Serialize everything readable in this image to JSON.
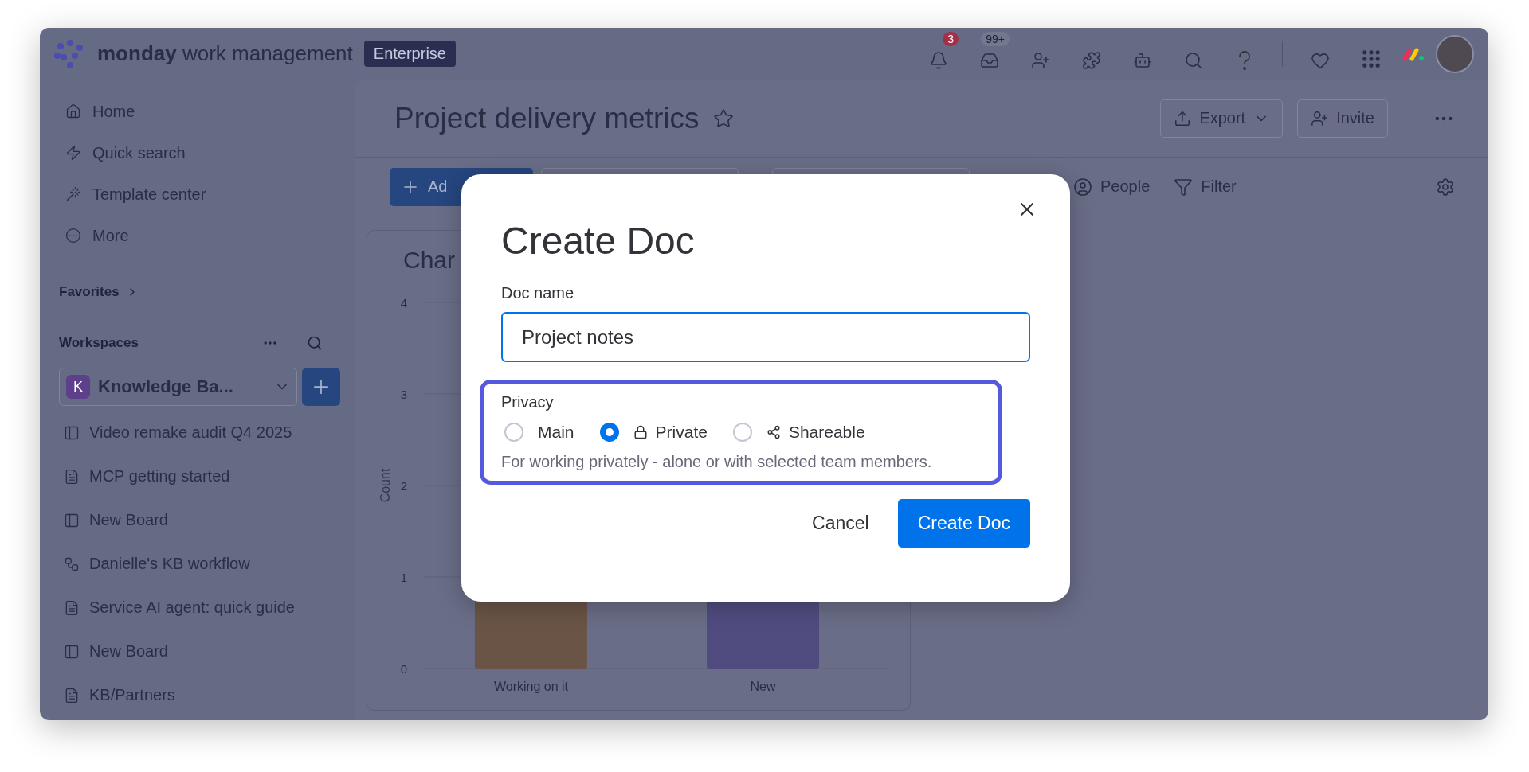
{
  "topbar": {
    "brand": "**monday** work management",
    "plan": "Enterprise",
    "notifications_badge": "3",
    "inbox_badge": "99+"
  },
  "sidebar": {
    "nav": [
      {
        "label": "Home",
        "kind": "home"
      },
      {
        "label": "Quick search",
        "kind": "search"
      },
      {
        "label": "Template center",
        "kind": "template"
      },
      {
        "label": "More",
        "kind": "more"
      }
    ],
    "favorites": "Favorites",
    "workspaces": "Workspaces",
    "workspace": {
      "initial": "K",
      "name": "Knowledge Ba..."
    },
    "items": [
      {
        "label": "Video remake audit Q4 2025",
        "kind": "board"
      },
      {
        "label": "MCP getting started",
        "kind": "doc"
      },
      {
        "label": "New Board",
        "kind": "board"
      },
      {
        "label": "Danielle's KB workflow",
        "kind": "workflow"
      },
      {
        "label": "Service AI agent: quick guide",
        "kind": "doc"
      },
      {
        "label": "New Board",
        "kind": "board"
      },
      {
        "label": "KB/Partners",
        "kind": "doc"
      }
    ]
  },
  "header": {
    "title": "Project delivery metrics",
    "export": "Export",
    "invite": "Invite"
  },
  "toolbar": {
    "add": "Ad",
    "people": "People",
    "filter": "Filter"
  },
  "chart": {
    "title": "Char",
    "y_label": "Count",
    "y_ticks": [
      "4",
      "3",
      "2",
      "1",
      "0"
    ],
    "bars": [
      {
        "label": "Working on it",
        "color": "#6a5446"
      },
      {
        "label": "New",
        "color": "#514c80"
      }
    ]
  },
  "dialog": {
    "title": "Create Doc",
    "name_label": "Doc name",
    "name_value": "Project notes",
    "privacy_label": "Privacy",
    "options": [
      {
        "label": "Main",
        "kind": "plain",
        "selected": false
      },
      {
        "label": "Private",
        "kind": "lock",
        "selected": true
      },
      {
        "label": "Shareable",
        "kind": "share",
        "selected": false
      }
    ],
    "description": "For working privately - alone or with selected team members.",
    "cancel": "Cancel",
    "submit": "Create Doc"
  }
}
